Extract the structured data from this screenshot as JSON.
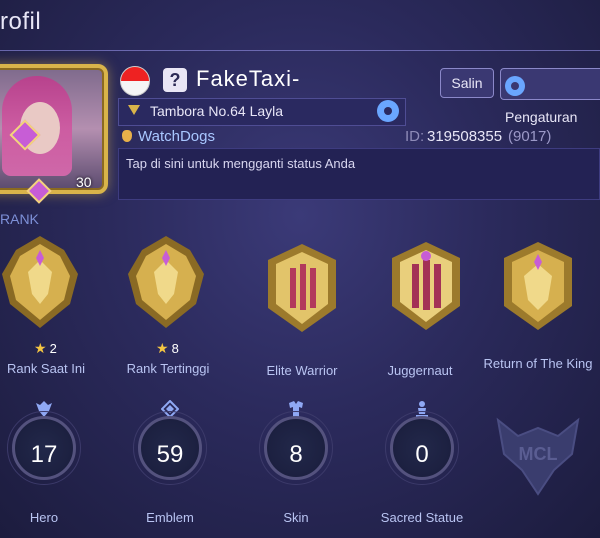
{
  "header": {
    "title": "rofil"
  },
  "profile": {
    "name": "FakeTaxi-",
    "level": "30",
    "help_label": "?",
    "copy_label": "Salin",
    "settings_label": "Pengaturan",
    "squad": "Tambora No.64 Layla",
    "platform": "WatchDogs",
    "id_prefix": "ID:",
    "id_value": "319508355",
    "id_extra": "(9017)",
    "status": "Tap di sini untuk mengganti status Anda"
  },
  "rank_section": {
    "label": "RANK",
    "items": [
      {
        "stars": "2",
        "label": "Rank Saat Ini"
      },
      {
        "stars": "8",
        "label": "Rank Tertinggi"
      },
      {
        "label": "Elite Warrior"
      },
      {
        "label": "Juggernaut"
      },
      {
        "label": "Return of The King"
      }
    ]
  },
  "stats": [
    {
      "value": "17",
      "label": "Hero",
      "icon": "hero-icon"
    },
    {
      "value": "59",
      "label": "Emblem",
      "icon": "emblem-icon"
    },
    {
      "value": "8",
      "label": "Skin",
      "icon": "skin-icon"
    },
    {
      "value": "0",
      "label": "Sacred Statue",
      "icon": "statue-icon"
    }
  ],
  "mcl": {
    "text": "MCL"
  },
  "colors": {
    "accent_gold": "#d9b44a",
    "gem_purple": "#c75dd6",
    "label_blue": "#b9c4f2"
  }
}
